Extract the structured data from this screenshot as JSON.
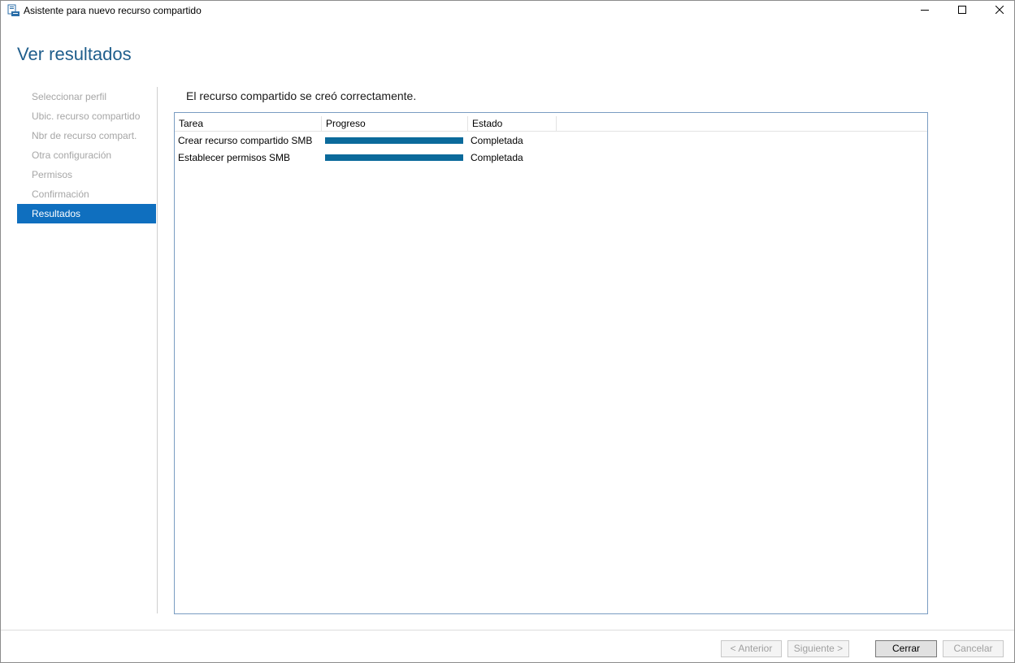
{
  "window": {
    "title": "Asistente para nuevo recurso compartido",
    "icon": "share-wizard-icon",
    "controls": {
      "minimize": "minimize-icon",
      "maximize": "maximize-icon",
      "close": "close-icon"
    }
  },
  "header": {
    "title": "Ver resultados"
  },
  "sidebar": {
    "items": [
      {
        "label": "Seleccionar perfil",
        "state": "disabled"
      },
      {
        "label": "Ubic. recurso compartido",
        "state": "disabled"
      },
      {
        "label": "Nbr de recurso compart.",
        "state": "disabled"
      },
      {
        "label": "Otra configuración",
        "state": "disabled"
      },
      {
        "label": "Permisos",
        "state": "disabled"
      },
      {
        "label": "Confirmación",
        "state": "disabled"
      },
      {
        "label": "Resultados",
        "state": "active"
      }
    ]
  },
  "main": {
    "message": "El recurso compartido se creó correctamente.",
    "table": {
      "columns": [
        "Tarea",
        "Progreso",
        "Estado"
      ],
      "rows": [
        {
          "task": "Crear recurso compartido SMB",
          "progress": 100,
          "status": "Completada"
        },
        {
          "task": "Establecer permisos SMB",
          "progress": 100,
          "status": "Completada"
        }
      ]
    }
  },
  "footer": {
    "prev_label": "< Anterior",
    "next_label": "Siguiente >",
    "close_label": "Cerrar",
    "cancel_label": "Cancelar"
  },
  "colors": {
    "title_blue": "#1f5e8c",
    "active_blue": "#0f6fbf",
    "progress_fill": "#0b6a9b",
    "disabled_text": "#a6a6a6"
  }
}
